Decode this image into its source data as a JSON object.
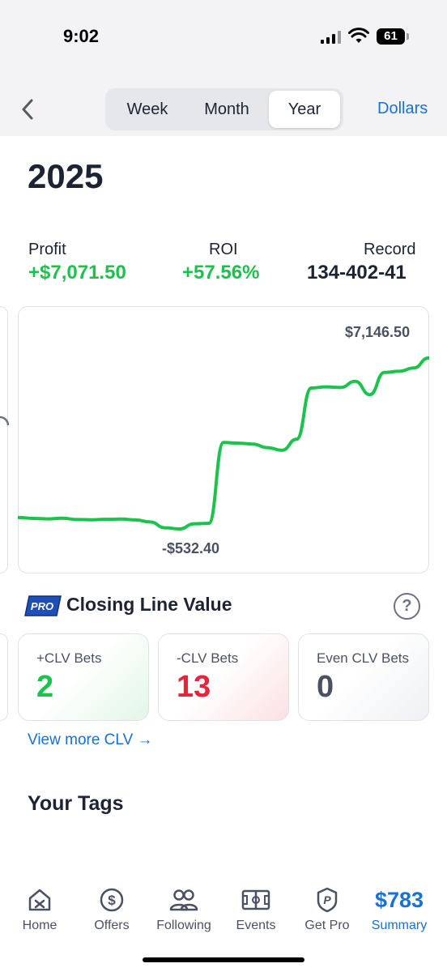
{
  "status_bar": {
    "time": "9:02",
    "battery": "61"
  },
  "nav": {
    "segments": [
      "Week",
      "Month",
      "Year"
    ],
    "selected": "Year",
    "currency_toggle": "Dollars"
  },
  "period_title": "2025",
  "stats": {
    "profit_label": "Profit",
    "profit_value": "+$7,071.50",
    "roi_label": "ROI",
    "roi_value": "+57.56%",
    "record_label": "Record",
    "record_value": "134-402-41"
  },
  "chart": {
    "max_label": "$7,146.50",
    "min_label": "-$532.40"
  },
  "chart_data": {
    "type": "line",
    "title": "",
    "xlabel": "",
    "ylabel": "",
    "ylim": [
      -532.4,
      7146.5
    ],
    "series": [
      {
        "values": [
          -20,
          -60,
          -80,
          -50,
          -110,
          -120,
          -100,
          -90,
          -130,
          -220,
          -480,
          -532.4,
          -300,
          -280,
          3350,
          3320,
          3280,
          3120,
          3000,
          3500,
          5800,
          5850,
          5820,
          6100,
          5500,
          6500,
          6550,
          6700,
          7146.5
        ]
      }
    ],
    "line_color": "#1bc24c"
  },
  "clv": {
    "badge": "PRO",
    "title": "Closing Line Value",
    "cards": [
      {
        "label": "+CLV Bets",
        "count": "2"
      },
      {
        "label": "-CLV Bets",
        "count": "13"
      },
      {
        "label": "Even CLV Bets",
        "count": "0"
      }
    ],
    "view_more": "View more CLV →"
  },
  "tags_title": "Your Tags",
  "tabbar": {
    "home": "Home",
    "offers": "Offers",
    "following": "Following",
    "events": "Events",
    "get_pro": "Get Pro",
    "summary": "Summary",
    "summary_value": "$783"
  },
  "colors": {
    "accent": "#1671d9",
    "positive": "#1bc24c",
    "negative": "#e8233c"
  }
}
